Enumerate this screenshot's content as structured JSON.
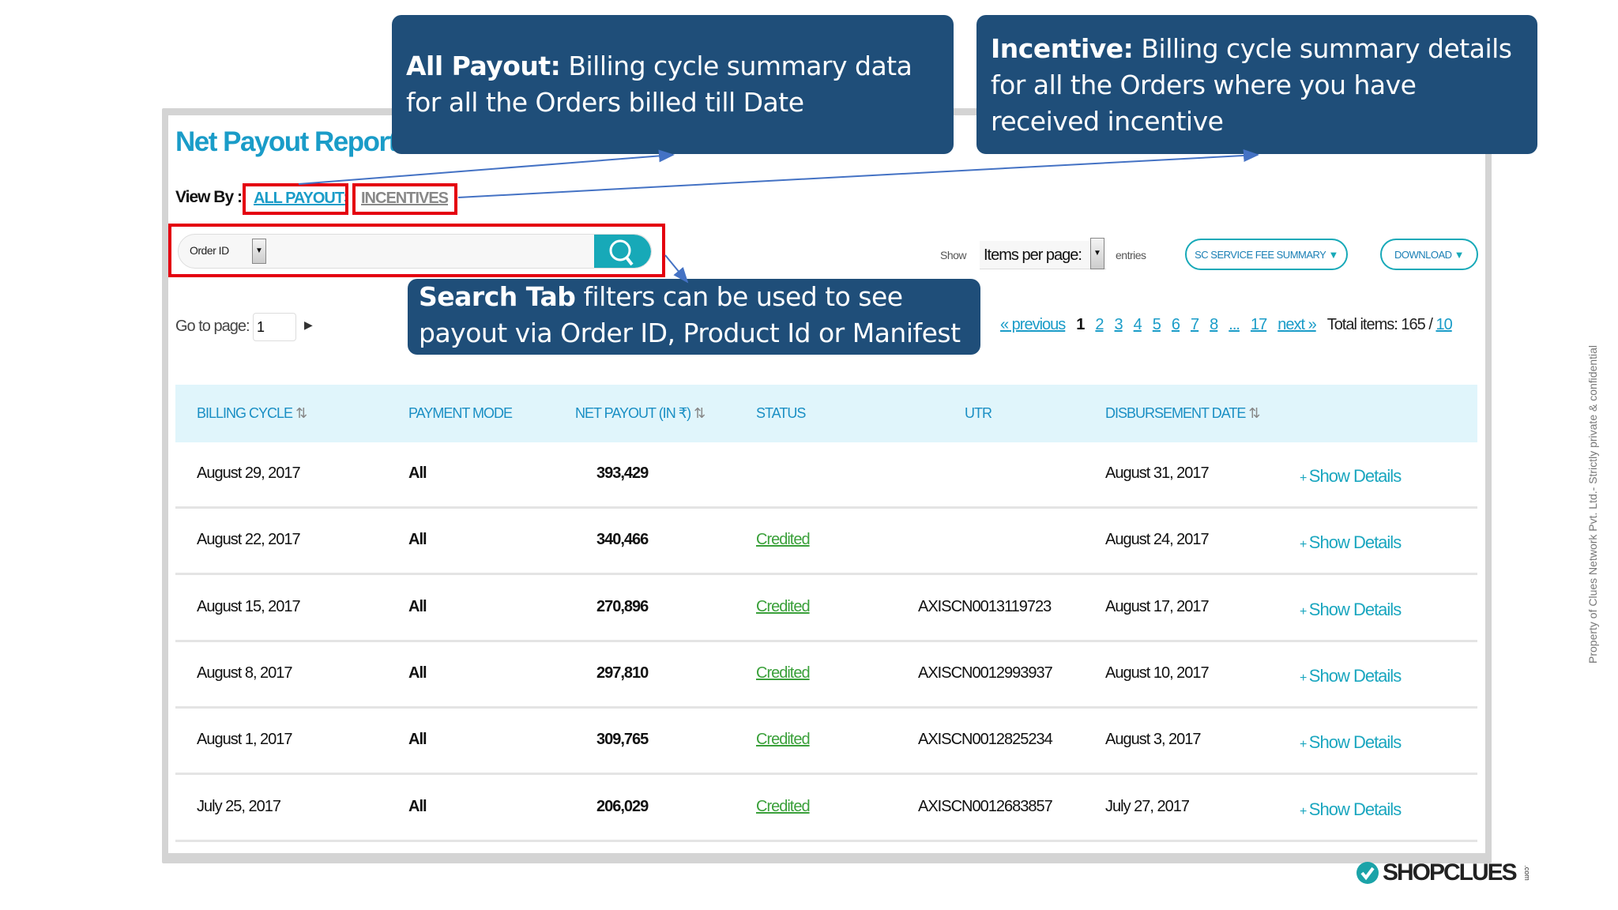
{
  "report": {
    "title": "Net Payout Report",
    "view_by_label": "View By :",
    "tabs": [
      "ALL PAYOUTS",
      "INCENTIVES"
    ]
  },
  "search": {
    "filter_value": "Order ID",
    "value": ""
  },
  "controls": {
    "show_label": "Show",
    "items_per_page_label": "Items per page:",
    "entries_label": "entries",
    "sc_service_fee_label": "SC SERVICE FEE SUMMARY",
    "download_label": "DOWNLOAD"
  },
  "goto": {
    "label": "Go to page:",
    "value": "1"
  },
  "pagination": {
    "previous": "« previous",
    "current": "1",
    "pages": [
      "2",
      "3",
      "4",
      "5",
      "6",
      "7",
      "8",
      "...",
      "17"
    ],
    "next": "next »",
    "total_label": "Total items:",
    "total": "165",
    "separator": "/",
    "per_page": "10"
  },
  "table": {
    "headers": [
      "BILLING CYCLE",
      "PAYMENT MODE",
      "NET PAYOUT (IN ₹)",
      "STATUS",
      "UTR",
      "DISBURSEMENT DATE"
    ],
    "action_label": "Show Details",
    "rows": [
      {
        "billing_cycle": "August 29, 2017",
        "mode": "All",
        "payout": "393,429",
        "status": "",
        "utr": "",
        "disbursement": "August 31, 2017"
      },
      {
        "billing_cycle": "August 22, 2017",
        "mode": "All",
        "payout": "340,466",
        "status": "Credited",
        "utr": "",
        "disbursement": "August 24, 2017"
      },
      {
        "billing_cycle": "August 15, 2017",
        "mode": "All",
        "payout": "270,896",
        "status": "Credited",
        "utr": "AXISCN0013119723",
        "disbursement": "August 17, 2017"
      },
      {
        "billing_cycle": "August 8, 2017",
        "mode": "All",
        "payout": "297,810",
        "status": "Credited",
        "utr": "AXISCN0012993937",
        "disbursement": "August 10, 2017"
      },
      {
        "billing_cycle": "August 1, 2017",
        "mode": "All",
        "payout": "309,765",
        "status": "Credited",
        "utr": "AXISCN0012825234",
        "disbursement": "August 3, 2017"
      },
      {
        "billing_cycle": "July 25, 2017",
        "mode": "All",
        "payout": "206,029",
        "status": "Credited",
        "utr": "AXISCN0012683857",
        "disbursement": "July 27, 2017"
      }
    ]
  },
  "callouts": [
    {
      "bold": "All Payout:",
      "text": " Billing cycle summary data for all the Orders billed till Date"
    },
    {
      "bold": "Incentive:",
      "text": " Billing cycle summary details for all the Orders  where you have received incentive"
    },
    {
      "bold": "Search Tab",
      "text": " filters can be used to see payout via Order ID, Product Id or Manifest Id"
    }
  ],
  "watermark": "Property of Clues Network Pvt. Ltd.- Strictly private & confidential",
  "logo": {
    "text": "SHOPCLUES",
    "suffix": ".com"
  },
  "colors": {
    "accent": "#1a9cc8",
    "callout": "#1f4e79",
    "highlight": "#e4000f",
    "credited": "#3aa03a"
  }
}
